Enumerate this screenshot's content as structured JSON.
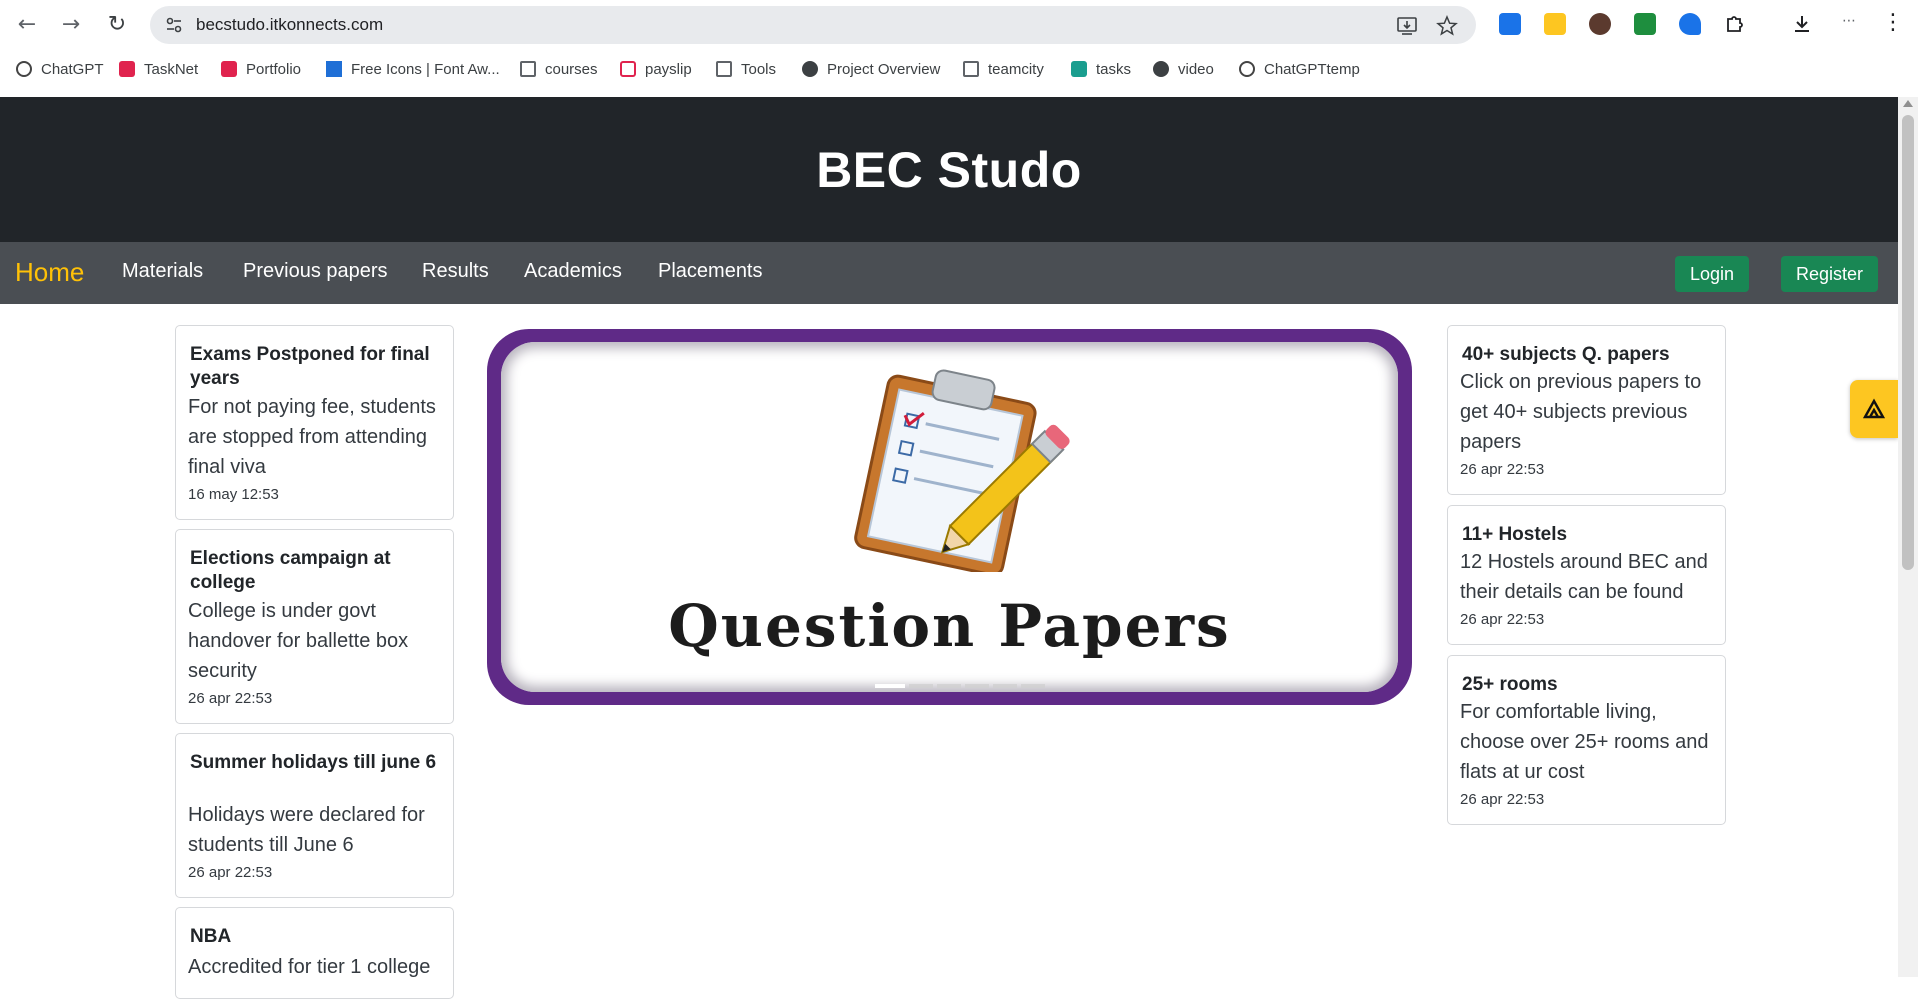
{
  "browser": {
    "url": "becstudo.itkonnects.com",
    "bookmarks": [
      "ChatGPT",
      "TaskNet",
      "Portfolio",
      "Free Icons | Font Aw...",
      "courses",
      "payslip",
      "Tools",
      "Project Overview",
      "teamcity",
      "tasks",
      "video",
      "ChatGPTtemp"
    ]
  },
  "site": {
    "title": "BEC Studo",
    "nav": [
      "Home",
      "Materials",
      "Previous papers",
      "Results",
      "Academics",
      "Placements"
    ],
    "login_label": "Login",
    "register_label": "Register"
  },
  "left_cards": [
    {
      "title": "Exams Postponed for final years",
      "body": "For not paying fee, students are stopped from attending final viva",
      "time": "16 may 12:53"
    },
    {
      "title": "Elections campaign at college",
      "body": "College is under govt handover for ballette box security",
      "time": "26 apr 22:53"
    },
    {
      "title": "Summer holidays till june 6",
      "body": "Holidays were declared for students till June 6",
      "time": "26 apr 22:53"
    },
    {
      "title": "NBA",
      "body": "Accredited for tier 1 college"
    }
  ],
  "right_cards": [
    {
      "title": "40+ subjects Q. papers",
      "body": "Click on previous papers to get 40+ subjects previous papers",
      "time": "26 apr 22:53"
    },
    {
      "title": "11+ Hostels",
      "body": "12 Hostels around BEC and their details can be found",
      "time": "26 apr 22:53"
    },
    {
      "title": "25+ rooms",
      "body": "For comfortable living, choose over 25+ rooms and flats at ur cost",
      "time": "26 apr 22:53"
    }
  ],
  "carousel": {
    "caption": "Question Papers",
    "slide_count": 6,
    "active_slide": 1
  },
  "colors": {
    "header": "#212529",
    "nav": "#4a4e53",
    "accent": "#ffc107",
    "button": "#198754",
    "frame": "#5f2a87"
  }
}
